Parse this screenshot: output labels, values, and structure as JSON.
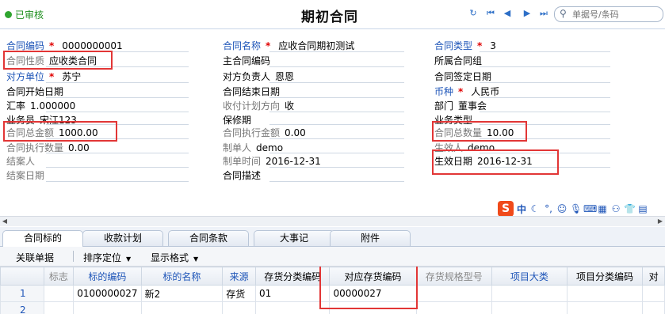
{
  "header": {
    "status": "已审核",
    "title": "期初合同",
    "search_placeholder": "单据号/条码"
  },
  "form": {
    "contract_code_label": "合同编码",
    "contract_code": "0000000001",
    "contract_name_label": "合同名称",
    "contract_name": "应收合同期初测试",
    "contract_type_label": "合同类型",
    "contract_type": "3",
    "contract_nature_label": "合同性质",
    "contract_nature": "应收类合同",
    "main_contract_code_label": "主合同编码",
    "contract_group_label": "所属合同组",
    "counterparty_label": "对方单位",
    "counterparty": "苏宁",
    "counterparty_person_label": "对方负责人",
    "counterparty_person": "恩恩",
    "sign_date_label": "合同签定日期",
    "start_date_label": "合同开始日期",
    "end_date_label": "合同结束日期",
    "currency_label": "币种",
    "currency": "人民币",
    "exchange_rate_label": "汇率",
    "exchange_rate": "1.000000",
    "pay_plan_direction_label": "收付计划方向",
    "pay_plan_direction": "收",
    "department_label": "部门",
    "department": "董事会",
    "salesperson_label": "业务员",
    "salesperson": "宋江123",
    "warranty_label": "保修期",
    "business_type_label": "业务类型",
    "total_amount_label": "合同总金额",
    "total_amount": "1000.00",
    "executed_amount_label": "合同执行金额",
    "executed_amount": "0.00",
    "total_quantity_label": "合同总数量",
    "total_quantity": "10.00",
    "executed_quantity_label": "合同执行数量",
    "executed_quantity": "0.00",
    "creator_label": "制单人",
    "creator": "demo",
    "effective_person_label": "生效人",
    "effective_person": "demo",
    "closer_label": "结案人",
    "create_time_label": "制单时间",
    "create_time": "2016-12-31",
    "effective_date_label": "生效日期",
    "effective_date": "2016-12-31",
    "close_date_label": "结案日期",
    "description_label": "合同描述"
  },
  "ime": {
    "logo": "S",
    "mode": "中"
  },
  "tabs": [
    "合同标的",
    "收款计划",
    "合同条款",
    "大事记",
    "附件"
  ],
  "toolbar": {
    "related_docs": "关联单据",
    "sort_locate": "排序定位",
    "display_format": "显示格式"
  },
  "grid": {
    "columns": [
      "标志",
      "标的编码",
      "标的名称",
      "来源",
      "存货分类编码",
      "对应存货编码",
      "存货规格型号",
      "项目大类",
      "项目分类编码",
      "对"
    ],
    "rows": [
      {
        "num": "1",
        "flag": "",
        "code": "0100000027",
        "name": "新2",
        "source": "存货",
        "category": "01",
        "inventory_code": "00000027",
        "spec": "",
        "project_class": "",
        "project_cat_code": ""
      },
      {
        "num": "2",
        "flag": "",
        "code": "",
        "name": "",
        "source": "",
        "category": "",
        "inventory_code": "",
        "spec": "",
        "project_class": "",
        "project_cat_code": ""
      }
    ]
  }
}
